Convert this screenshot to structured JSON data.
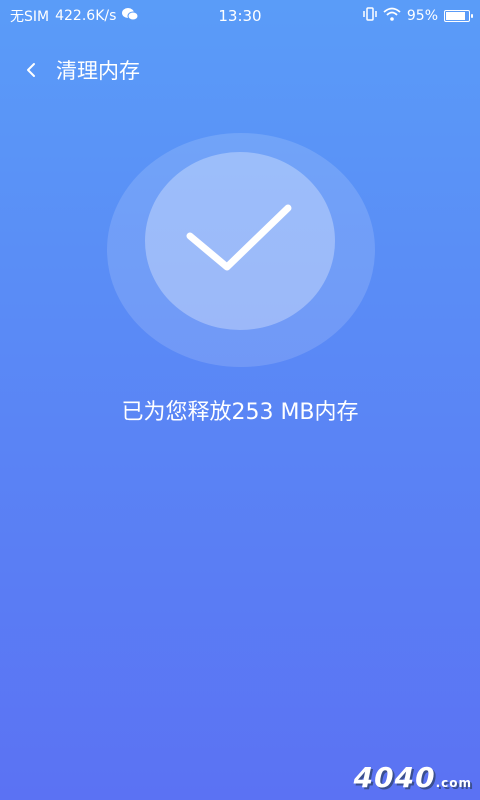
{
  "status_bar": {
    "carrier": "无SIM",
    "net_speed": "422.6K/s",
    "time": "13:30",
    "battery_text": "95%",
    "battery_level": 0.95,
    "icons": [
      "wechat-icon",
      "vibrate-icon",
      "wifi-icon",
      "battery-icon"
    ]
  },
  "header": {
    "back_icon": "chevron-left-icon",
    "title": "清理内存"
  },
  "result": {
    "icon": "checkmark-icon",
    "message": "已为您释放253 MB内存"
  },
  "watermark": {
    "text": "4040",
    "suffix": ".com"
  },
  "colors": {
    "background_top": "#5a9cf8",
    "background_bottom": "#5b72f3",
    "text": "#ffffff"
  }
}
